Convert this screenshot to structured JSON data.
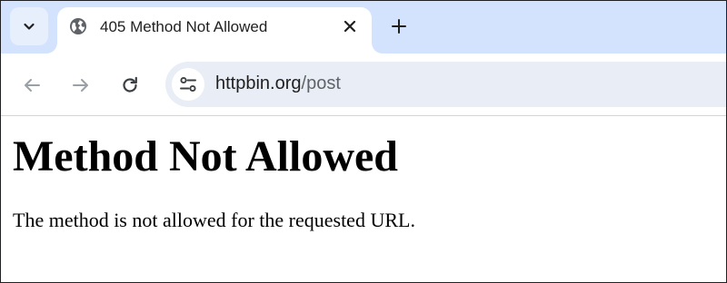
{
  "browser": {
    "tab": {
      "title": "405 Method Not Allowed",
      "favicon_icon": "globe-icon",
      "close_icon": "close-icon"
    },
    "tab_search_icon": "chevron-down-icon",
    "new_tab_icon": "plus-icon",
    "toolbar": {
      "back_icon": "arrow-left-icon",
      "forward_icon": "arrow-right-icon",
      "reload_icon": "reload-icon",
      "site_info_icon": "tune-icon"
    },
    "address_bar": {
      "host": "httpbin.org",
      "path": "/post"
    },
    "colors": {
      "tabstrip": "#d3e3fd",
      "omnibox": "#e9eef6",
      "text": "#1f1f1f",
      "muted": "#5f6368"
    }
  },
  "page": {
    "heading": "Method Not Allowed",
    "message": "The method is not allowed for the requested URL."
  }
}
